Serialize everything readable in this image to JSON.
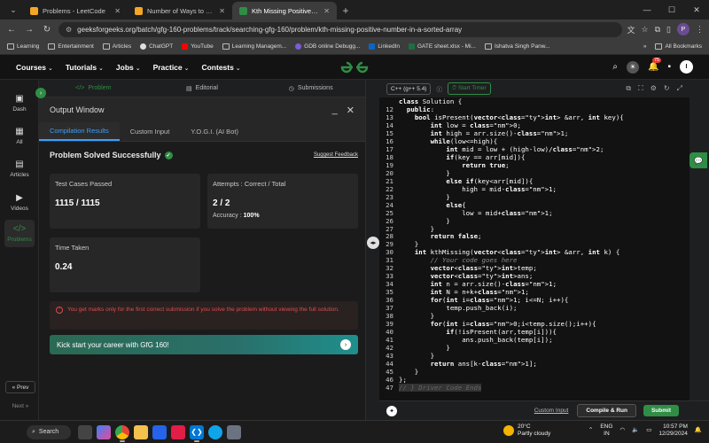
{
  "browser": {
    "tabs": [
      {
        "title": "Problems - LeetCode",
        "color": "#f5a623",
        "active": false
      },
      {
        "title": "Number of Ways to Form a Targ",
        "color": "#f5a623",
        "active": false
      },
      {
        "title": "Kth Missing Positive Number in",
        "color": "#2f8d46",
        "active": true
      }
    ],
    "new_tab": "+",
    "url": "geeksforgeeks.org/batch/gfg-160-problems/track/searching-gfg-160/problem/kth-missing-positive-number-in-a-sorted-array",
    "profile_initial": "P",
    "bookmarks": [
      "Learning",
      "Entertainment",
      "Articles",
      "ChatGPT",
      "YouTube",
      "Learning Managem...",
      "GDB online Debugg...",
      "LinkedIn",
      "GATE sheet.xlsx - Mi...",
      "Ishatva Singh Panw..."
    ],
    "bookmarks_more": "»",
    "all_bookmarks": "All Bookmarks"
  },
  "gfg": {
    "nav": [
      "Courses",
      "Tutorials",
      "Jobs",
      "Practice",
      "Contests"
    ],
    "notification_count": "75",
    "user_initial": "I",
    "logo_color": "#2f8d46"
  },
  "leftnav": {
    "items": [
      {
        "label": "Dash",
        "icon": "▣"
      },
      {
        "label": "All",
        "icon": "▦"
      },
      {
        "label": "Articles",
        "icon": "▤"
      },
      {
        "label": "Videos",
        "icon": "▶"
      },
      {
        "label": "Problems",
        "icon": "</>"
      }
    ],
    "prev": "« Prev",
    "next": "Next »"
  },
  "problem_tabs": {
    "problem": "Problem",
    "editorial": "Editorial",
    "submissions": "Submissions"
  },
  "output": {
    "title": "Output Window",
    "minimize": "_",
    "close": "✕",
    "tabs": [
      "Compilation Results",
      "Custom Input",
      "Y.O.G.I. (AI Bot)"
    ],
    "status": "Problem Solved Successfully",
    "feedback": "Suggest Feedback",
    "test_cases_label": "Test Cases Passed",
    "test_cases_value": "1115 / 1115",
    "attempts_label": "Attempts : Correct / Total",
    "attempts_value": "2 / 2",
    "accuracy_label": "Accuracy :",
    "accuracy_value": "100%",
    "time_label": "Time Taken",
    "time_value": "0.24",
    "warning": "You get marks only for the first correct submission if you solve the problem without viewing the full solution.",
    "promo": "Kick start your career with GfG 160!"
  },
  "editor": {
    "language": "C++ (g++ 5.4)",
    "timer": "Start Timer",
    "line_numbers": [
      "",
      "12",
      "13",
      "14",
      "15",
      "16",
      "17",
      "18",
      "19",
      "20",
      "21",
      "22",
      "23",
      "24",
      "25",
      "26",
      "27",
      "28",
      "29",
      "30",
      "31",
      "32",
      "33",
      "34",
      "35",
      "36",
      "37",
      "38",
      "39",
      "40",
      "41",
      "42",
      "43",
      "44",
      "45",
      "46",
      "47"
    ],
    "lines": [
      "class Solution {",
      "  public:",
      "    bool isPresent(vector<int> &arr, int key){",
      "        int low = 0;",
      "        int high = arr.size()-1;",
      "        while(low<=high){",
      "            int mid = low + (high-low)/2;",
      "            if(key == arr[mid]){",
      "                return true;",
      "            }",
      "            else if(key<arr[mid]){",
      "                high = mid-1;",
      "            }",
      "            else{",
      "                low = mid+1;",
      "            }",
      "        }",
      "        return false;",
      "    }",
      "    int kthMissing(vector<int> &arr, int k) {",
      "        // Your code goes here",
      "        vector<int>temp;",
      "        vector<int>ans;",
      "        int n = arr.size()-1;",
      "        int N = n+k+1;",
      "        for(int i=1; i<=N; i++){",
      "            temp.push_back(i);",
      "        }",
      "        for(int i=0;i<temp.size();i++){",
      "            if(!isPresent(arr,temp[i])){",
      "                ans.push_back(temp[i]);",
      "            }",
      "        }",
      "        return ans[k-1];",
      "    }",
      "};",
      "// } Driver Code Ends"
    ],
    "custom_input": "Custom Input",
    "compile_run": "Compile & Run",
    "submit": "Submit"
  },
  "taskbar": {
    "search": "Search",
    "weather_temp": "20°C",
    "weather_desc": "Partly cloudy",
    "lang": "ENG",
    "region": "IN",
    "time": "10:57 PM",
    "date": "12/29/2024"
  }
}
